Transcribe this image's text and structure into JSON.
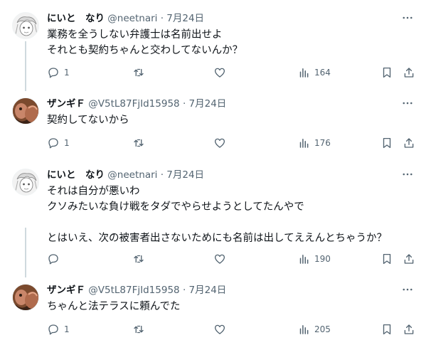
{
  "tweets": [
    {
      "name": "にいと　なり",
      "handle": "@neetnari",
      "dot": "·",
      "date": "7月24日",
      "lines": [
        "業務を全うしない弁護士は名前出せよ",
        "それとも契約ちゃんと交わしてないんか？"
      ],
      "replies": "1",
      "views": "164"
    },
    {
      "name": "ザンギＦ",
      "handle": "@V5tL87FjId15958",
      "dot": "·",
      "date": "7月24日",
      "lines": [
        "契約してないから"
      ],
      "replies": "1",
      "views": "176"
    },
    {
      "name": "にいと　なり",
      "handle": "@neetnari",
      "dot": "·",
      "date": "7月24日",
      "lines": [
        "それは自分が悪いわ",
        "クソみたいな負け戦をタダでやらせようとしてたんやで",
        "",
        "とはいえ、次の被害者出さないためにも名前は出してええんとちゃうか？"
      ],
      "replies": "",
      "views": "190"
    },
    {
      "name": "ザンギＦ",
      "handle": "@V5tL87FjId15958",
      "dot": "·",
      "date": "7月24日",
      "lines": [
        "ちゃんと法テラスに頼んでた"
      ],
      "replies": "1",
      "views": "205"
    }
  ],
  "icons": {
    "reply": "reply-icon",
    "retweet": "retweet-icon",
    "like": "heart-icon",
    "views": "views-chart-icon",
    "bookmark": "bookmark-icon",
    "share": "share-icon",
    "more": "more-icon"
  },
  "colors": {
    "text": "#0f1419",
    "secondary": "#536471",
    "thread_line": "#cfd9de"
  }
}
